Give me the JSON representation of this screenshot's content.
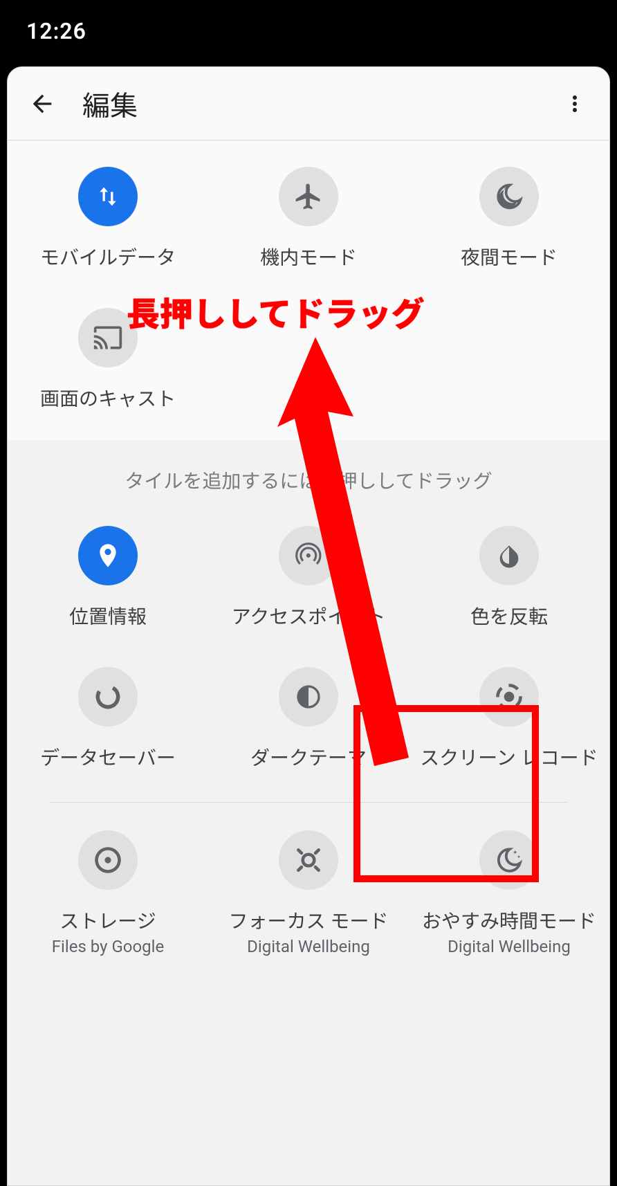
{
  "status": {
    "time": "12:26"
  },
  "header": {
    "title": "編集"
  },
  "active_tiles": [
    {
      "id": "mobile-data",
      "label": "モバイルデータ",
      "active": true
    },
    {
      "id": "airplane-mode",
      "label": "機内モード",
      "active": false
    },
    {
      "id": "night-mode",
      "label": "夜間モード",
      "active": false
    },
    {
      "id": "cast",
      "label": "画面のキャスト",
      "active": false
    }
  ],
  "hint": "タイルを追加するには長押ししてドラッグ",
  "inactive_tiles_row1": [
    {
      "id": "location",
      "label": "位置情報",
      "active": true
    },
    {
      "id": "hotspot",
      "label": "アクセスポイント",
      "active": false
    },
    {
      "id": "invert-colors",
      "label": "色を反転",
      "active": false
    }
  ],
  "inactive_tiles_row2": [
    {
      "id": "data-saver",
      "label": "データセーバー",
      "active": false
    },
    {
      "id": "dark-theme",
      "label": "ダークテーマ",
      "active": false
    },
    {
      "id": "screen-record",
      "label": "スクリーン レコード",
      "active": false
    }
  ],
  "inactive_tiles_row3": [
    {
      "id": "storage",
      "label": "ストレージ",
      "sub": "Files by Google",
      "active": false
    },
    {
      "id": "focus-mode",
      "label": "フォーカス モード",
      "sub": "Digital Wellbeing",
      "active": false
    },
    {
      "id": "bedtime-mode",
      "label": "おやすみ時間モード",
      "sub": "Digital Wellbeing",
      "active": false
    }
  ],
  "annotation": {
    "text": "長押ししてドラッグ",
    "highlight_tile": "screen-record"
  }
}
